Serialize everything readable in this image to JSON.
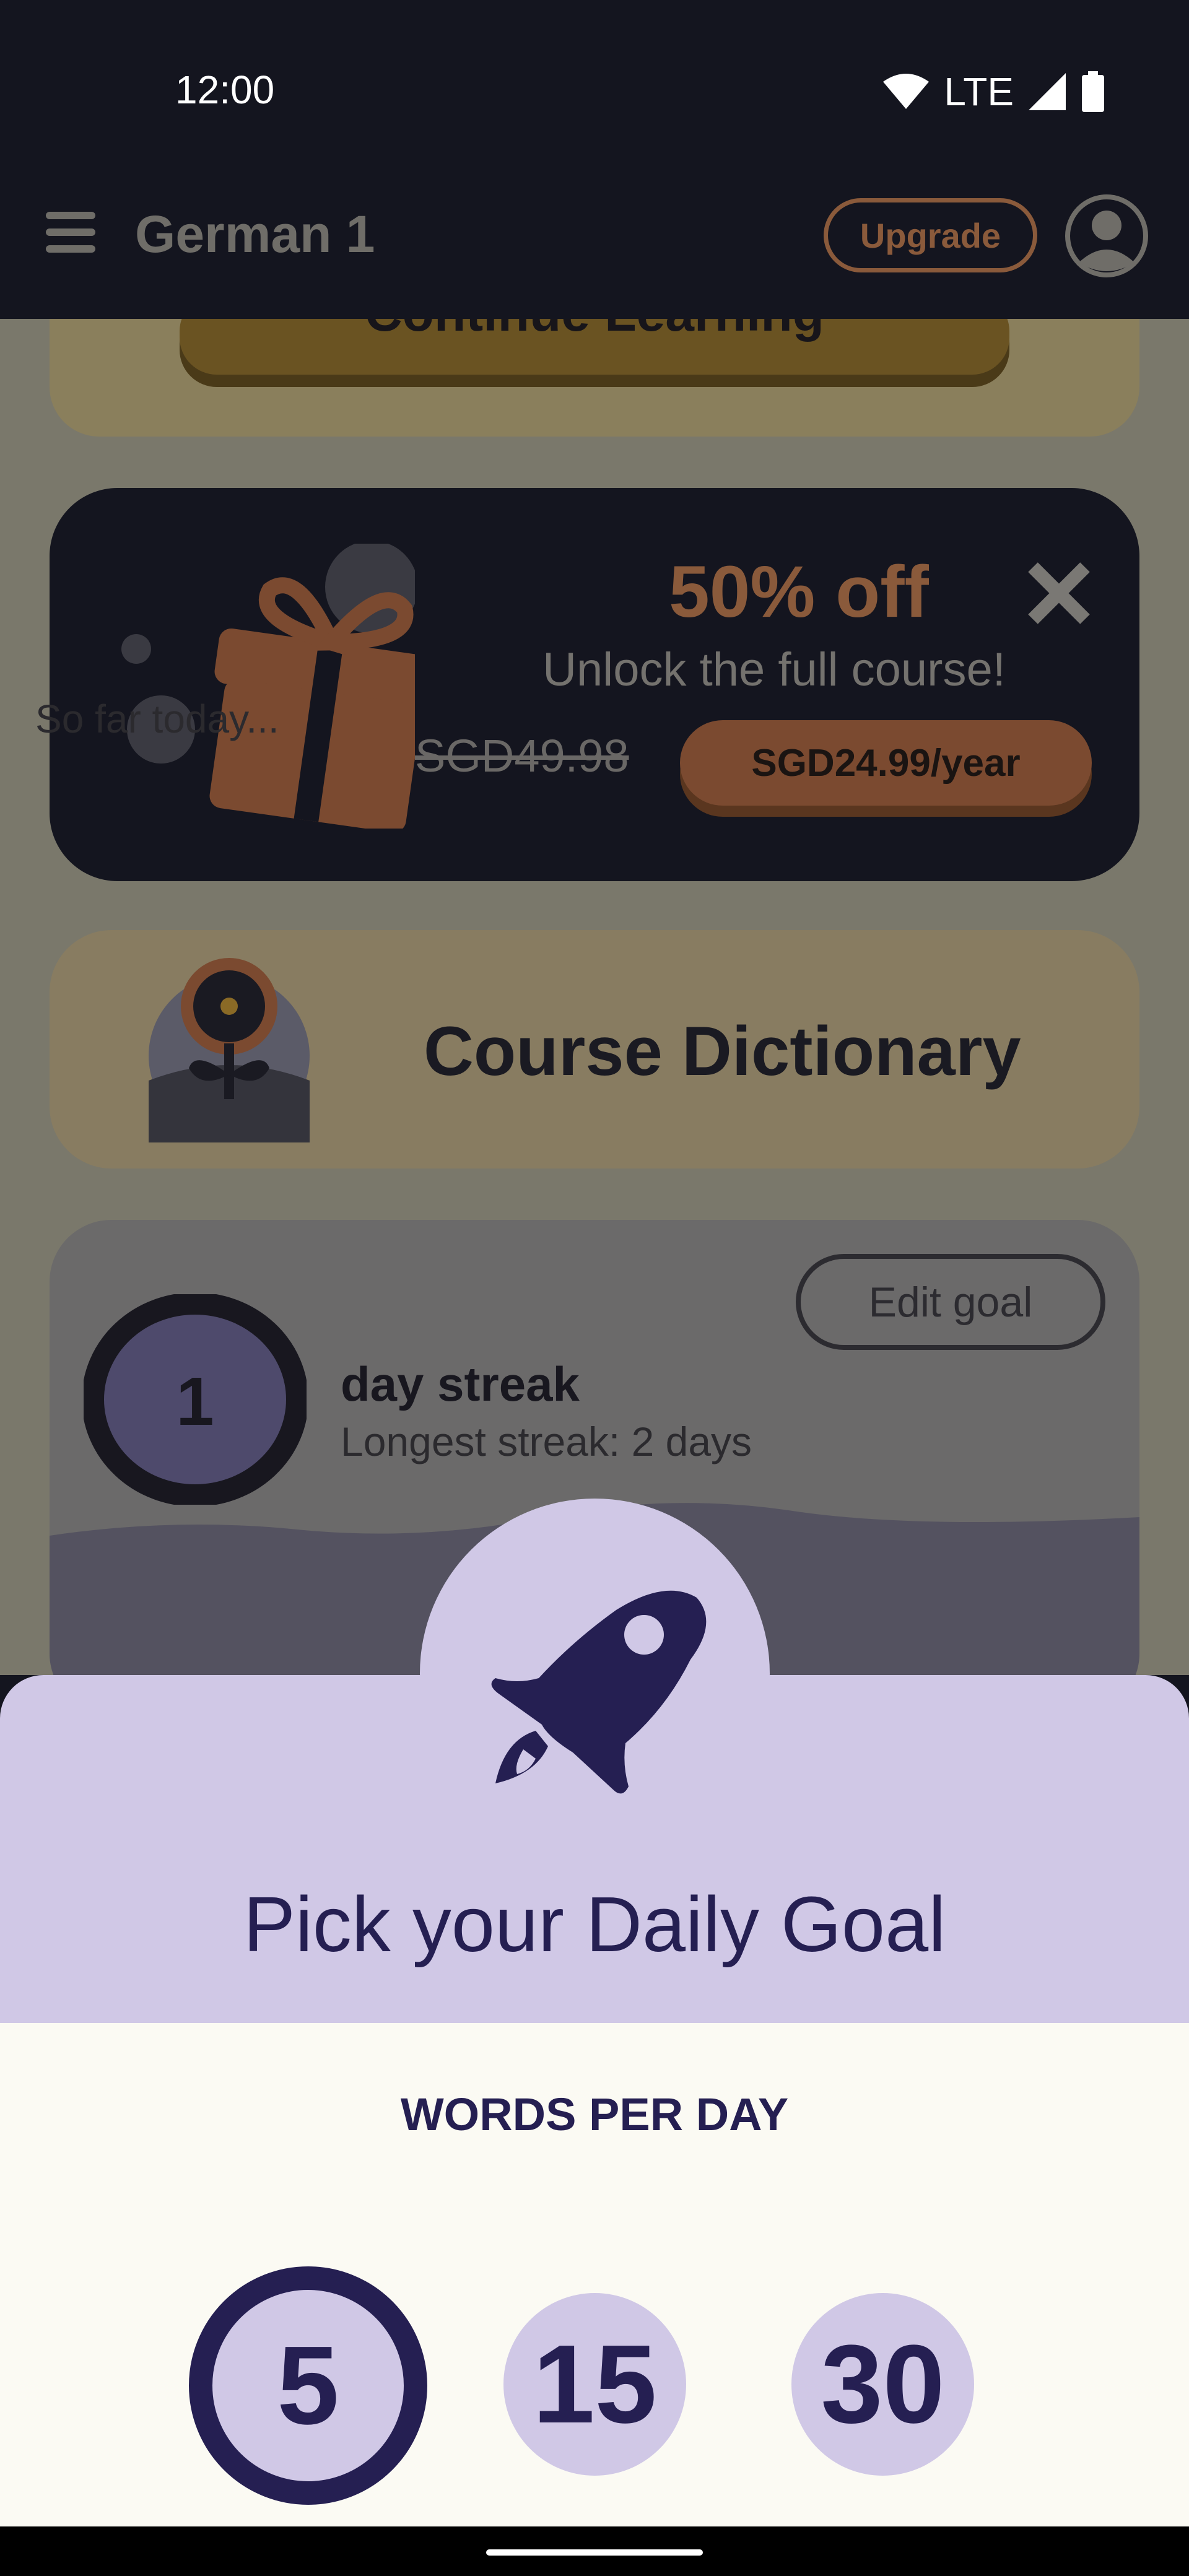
{
  "status_bar": {
    "time": "12:00",
    "network": "LTE",
    "icons": [
      "wifi-icon",
      "signal-icon",
      "battery-icon"
    ]
  },
  "app_bar": {
    "title": "German 1",
    "upgrade_label": "Upgrade",
    "icons": [
      "menu-icon",
      "avatar-icon"
    ]
  },
  "continue_card": {
    "label": "Continue Learning"
  },
  "promo": {
    "title": "50% off",
    "subtitle": "Unlock the full course!",
    "original_price": "SGD49.98",
    "offer_price": "SGD24.99/year",
    "icons": [
      "gift-icon",
      "close-icon"
    ]
  },
  "dictionary": {
    "label": "Course Dictionary",
    "icon": "flower-icon"
  },
  "streak": {
    "edit_goal_label": "Edit goal",
    "count": "1",
    "label": "day streak",
    "longest": "Longest streak: 2 days",
    "so_far_today": "So far today..."
  },
  "daily_goal_sheet": {
    "icon": "rocket-icon",
    "title": "Pick your Daily Goal",
    "unit_label": "WORDS PER DAY",
    "options": [
      "5",
      "15",
      "30"
    ],
    "selected": "5"
  },
  "colors": {
    "dark": "#14151f",
    "accent_brown": "#8a5a3b",
    "sheet_lavender": "#d0c8e6",
    "sheet_navy": "#251f52",
    "sheet_cream": "#fbfaf3"
  }
}
